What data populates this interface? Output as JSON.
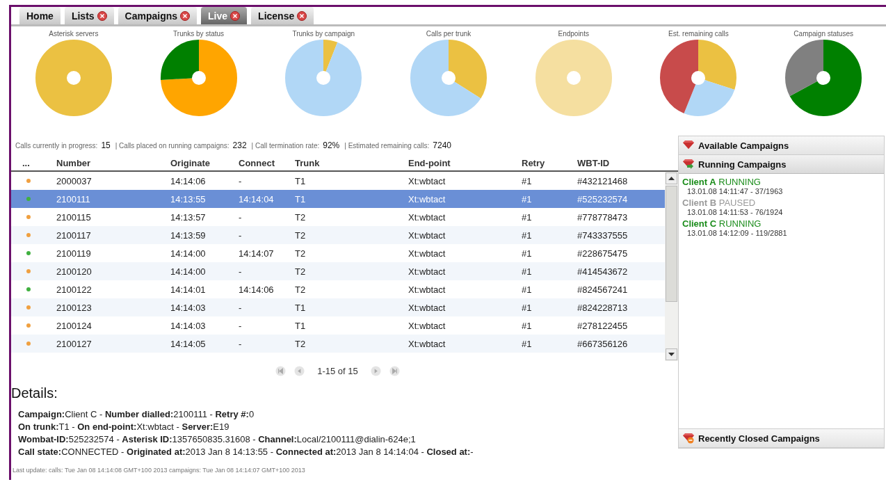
{
  "tabs": [
    {
      "label": "Home",
      "closable": false,
      "selected": false
    },
    {
      "label": "Lists",
      "closable": true,
      "selected": false
    },
    {
      "label": "Campaigns",
      "closable": true,
      "selected": false
    },
    {
      "label": "Live",
      "closable": true,
      "selected": true
    },
    {
      "label": "License",
      "closable": true,
      "selected": false
    }
  ],
  "charts": [
    {
      "title": "Asterisk servers"
    },
    {
      "title": "Trunks by status"
    },
    {
      "title": "Trunks by campaign"
    },
    {
      "title": "Calls per trunk"
    },
    {
      "title": "Endpoints"
    },
    {
      "title": "Est. remaining calls"
    },
    {
      "title": "Campaign statuses"
    }
  ],
  "stats": [
    {
      "label": "Calls currently in progress:",
      "value": "15"
    },
    {
      "label": "| Calls placed on running campaigns:",
      "value": "232"
    },
    {
      "label": "| Call termination rate:",
      "value": "92%"
    },
    {
      "label": "| Estimated remaining calls:",
      "value": "7240"
    }
  ],
  "table": {
    "status_header": "...",
    "columns": [
      "Number",
      "Originate",
      "Connect",
      "Trunk",
      "End-point",
      "Retry",
      "WBT-ID"
    ],
    "rows": [
      {
        "color": "#f0a040",
        "selected": false,
        "cells": [
          "2000037",
          "14:14:06",
          "-",
          "T1",
          "Xt:wbtact",
          "#1",
          "#432121468"
        ]
      },
      {
        "color": "#40b040",
        "selected": true,
        "cells": [
          "2100111",
          "14:13:55",
          "14:14:04",
          "T1",
          "Xt:wbtact",
          "#1",
          "#525232574"
        ]
      },
      {
        "color": "#f0a040",
        "selected": false,
        "cells": [
          "2100115",
          "14:13:57",
          "-",
          "T2",
          "Xt:wbtact",
          "#1",
          "#778778473"
        ]
      },
      {
        "color": "#f0a040",
        "selected": false,
        "cells": [
          "2100117",
          "14:13:59",
          "-",
          "T2",
          "Xt:wbtact",
          "#1",
          "#743337555"
        ]
      },
      {
        "color": "#40b040",
        "selected": false,
        "cells": [
          "2100119",
          "14:14:00",
          "14:14:07",
          "T2",
          "Xt:wbtact",
          "#1",
          "#228675475"
        ]
      },
      {
        "color": "#f0a040",
        "selected": false,
        "cells": [
          "2100120",
          "14:14:00",
          "-",
          "T2",
          "Xt:wbtact",
          "#1",
          "#414543672"
        ]
      },
      {
        "color": "#40b040",
        "selected": false,
        "cells": [
          "2100122",
          "14:14:01",
          "14:14:06",
          "T2",
          "Xt:wbtact",
          "#1",
          "#824567241"
        ]
      },
      {
        "color": "#f0a040",
        "selected": false,
        "cells": [
          "2100123",
          "14:14:03",
          "-",
          "T1",
          "Xt:wbtact",
          "#1",
          "#824228713"
        ]
      },
      {
        "color": "#f0a040",
        "selected": false,
        "cells": [
          "2100124",
          "14:14:03",
          "-",
          "T1",
          "Xt:wbtact",
          "#1",
          "#278122455"
        ]
      },
      {
        "color": "#f0a040",
        "selected": false,
        "cells": [
          "2100127",
          "14:14:05",
          "-",
          "T2",
          "Xt:wbtact",
          "#1",
          "#667356126"
        ]
      }
    ]
  },
  "pager": {
    "text": "1-15 of 15"
  },
  "details": {
    "heading": "Details:",
    "lines": [
      "**Campaign:**Client C - **Number dialled:**2100111 - **Retry #:**0",
      "**On trunk:**T1 - **On end-point:**Xt:wbtact - **Server:**E19",
      "**Wombat-ID:**525232574 - **Asterisk ID:**1357650835.31608 - **Channel:**Local/2100111@dialin-624e;1",
      "**Call state:**CONNECTED - **Originated at:**2013 Jan 8 14:13:55 - **Connected at:**2013 Jan 8 14:14:04 - **Closed at:**-"
    ]
  },
  "last_update": "Last update: calls: Tue Jan 08 14:14:08 GMT+100 2013 campaigns: Tue Jan 08 14:14:07 GMT+100 2013",
  "panel": {
    "sections": [
      {
        "kind": "available",
        "title": "Available Campaigns",
        "expanded": false
      },
      {
        "kind": "running",
        "title": "Running Campaigns",
        "expanded": true,
        "campaigns": [
          {
            "name": "Client A",
            "status": "RUNNING",
            "color": "#1a8c1a",
            "info": "13.01.08 14:11:47 - 37/1963"
          },
          {
            "name": "Client B",
            "status": "PAUSED",
            "color": "#9a9a9a",
            "info": "13.01.08 14:11:53 - 76/1924"
          },
          {
            "name": "Client C",
            "status": "RUNNING",
            "color": "#1a8c1a",
            "info": "13.01.08 14:12:09 - 119/2881"
          }
        ]
      },
      {
        "kind": "closed",
        "title": "Recently Closed Campaigns",
        "expanded": false
      }
    ]
  }
}
